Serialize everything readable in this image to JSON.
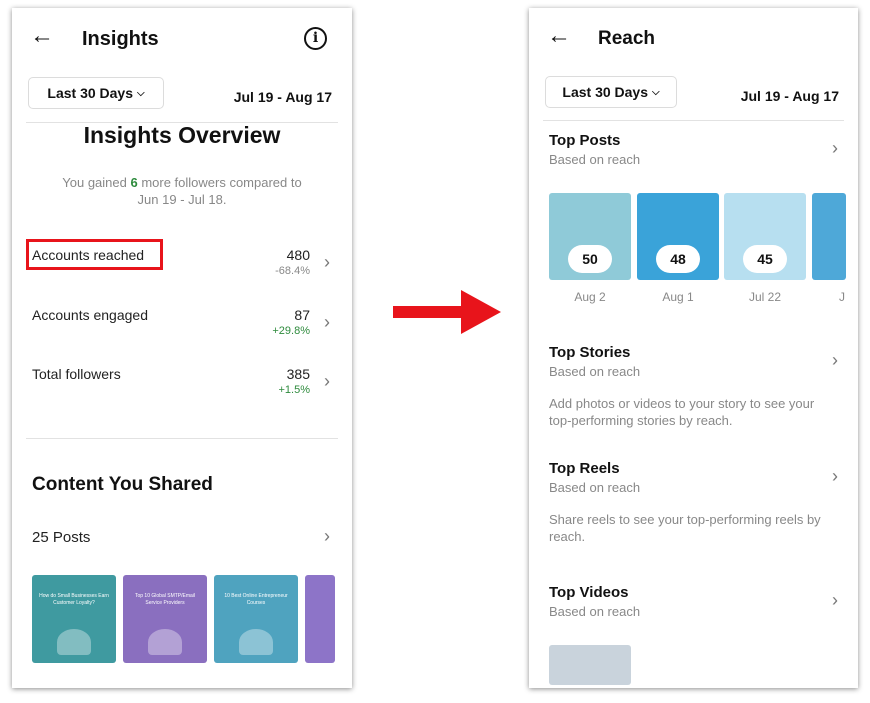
{
  "left": {
    "header": {
      "title": "Insights",
      "back_icon": "arrow-left",
      "info_icon": "info-circle"
    },
    "filter": {
      "selected": "Last 30 Days",
      "date_range": "Jul 19 - Aug 17"
    },
    "overview": {
      "title": "Insights Overview",
      "gain_prefix": "You gained ",
      "gain_count": "6",
      "gain_suffix": " more followers compared to",
      "gain_period": "Jun 19 - Jul 18."
    },
    "metrics": [
      {
        "label": "Accounts reached",
        "value": "480",
        "change": "-68.4%",
        "highlighted": true
      },
      {
        "label": "Accounts engaged",
        "value": "87",
        "change": "+29.8%"
      },
      {
        "label": "Total followers",
        "value": "385",
        "change": "+1.5%"
      }
    ],
    "content": {
      "title": "Content You Shared",
      "posts_label": "25 Posts",
      "thumbnails": [
        {
          "caption": "How do Small Businesses Earn Customer Loyalty?",
          "color": "#3f9aa0"
        },
        {
          "caption": "Top 10 Global SMTP/Email Service Providers",
          "color": "#8a6fbf"
        },
        {
          "caption": "10 Best Online Entrepreneur Courses",
          "color": "#4fa3bf"
        },
        {
          "caption": "",
          "color": "#8d74c8"
        }
      ]
    }
  },
  "right": {
    "header": {
      "title": "Reach",
      "back_icon": "arrow-left"
    },
    "filter": {
      "selected": "Last 30 Days",
      "date_range": "Jul 19 - Aug 17"
    },
    "top_posts": {
      "title": "Top Posts",
      "subtitle": "Based on reach",
      "posts": [
        {
          "reach": "50",
          "date": "Aug 2",
          "color": "#8fcad8"
        },
        {
          "reach": "48",
          "date": "Aug 1",
          "color": "#3aa3d9"
        },
        {
          "reach": "45",
          "date": "Jul 22",
          "color": "#b7dff0"
        },
        {
          "reach": "",
          "date": "J",
          "color": "#4ea8d8"
        }
      ]
    },
    "top_stories": {
      "title": "Top Stories",
      "subtitle": "Based on reach",
      "empty_text": "Add photos or videos to your story to see your top-performing stories by reach."
    },
    "top_reels": {
      "title": "Top Reels",
      "subtitle": "Based on reach",
      "empty_text": "Share reels to see your top-performing reels by reach."
    },
    "top_videos": {
      "title": "Top Videos",
      "subtitle": "Based on reach"
    }
  },
  "colors": {
    "highlight_box": "#e8141b",
    "arrow": "#e8141b",
    "positive": "#2e8b3d",
    "negative": "#888888"
  }
}
